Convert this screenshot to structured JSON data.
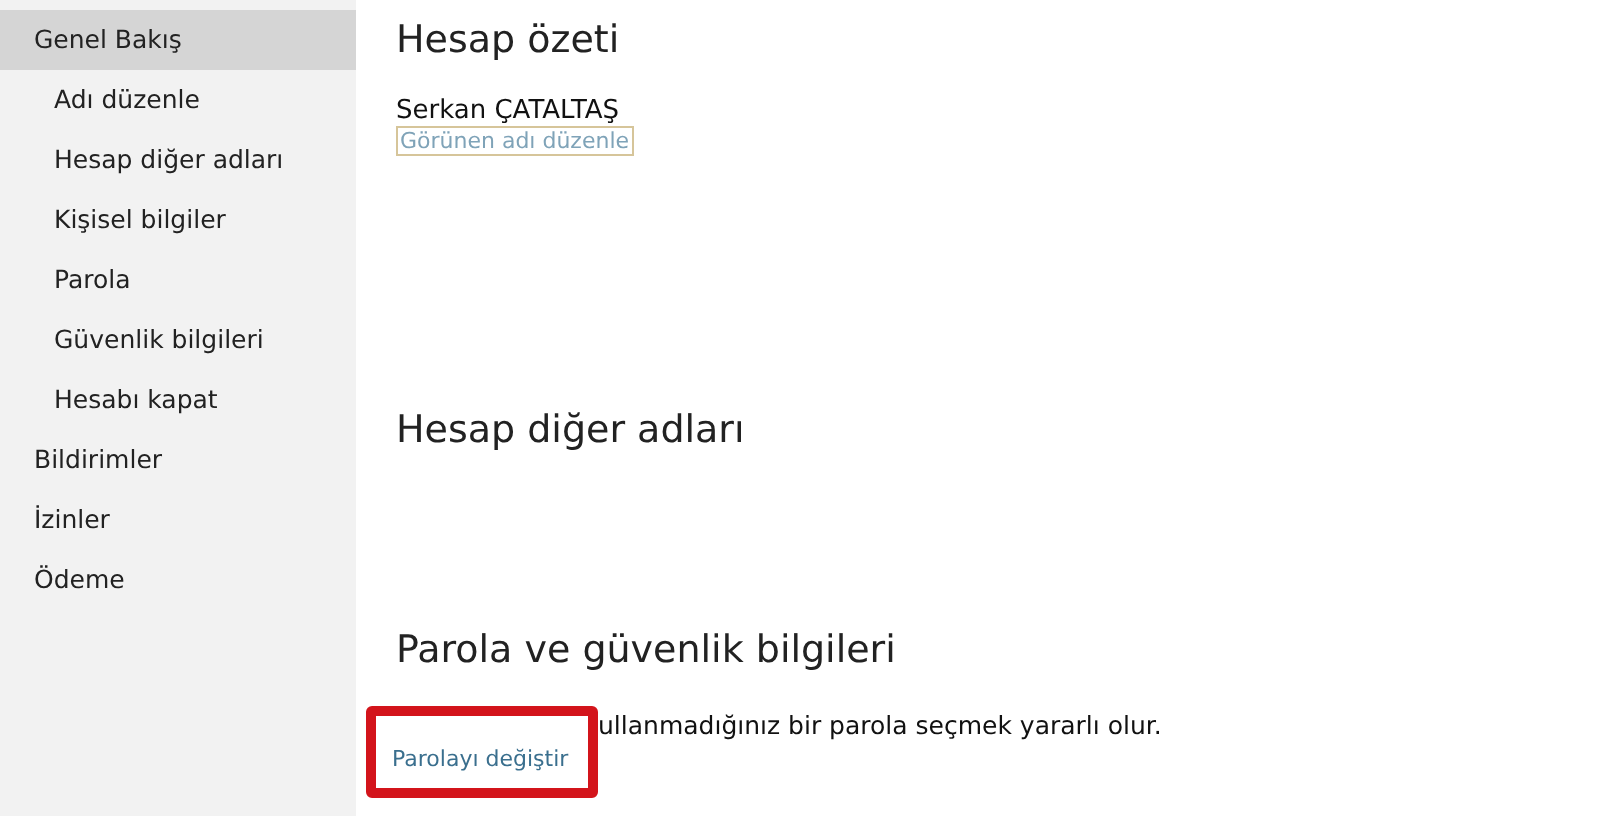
{
  "sidebar": {
    "items": [
      {
        "label": "Genel Bakış",
        "selected": true,
        "children": [
          {
            "label": "Adı düzenle",
            "selected": false
          },
          {
            "label": "Hesap diğer adları",
            "selected": false
          },
          {
            "label": "Kişisel bilgiler",
            "selected": false
          },
          {
            "label": "Parola",
            "selected": false
          },
          {
            "label": "Güvenlik bilgileri",
            "selected": false
          },
          {
            "label": "Hesabı kapat",
            "selected": false
          }
        ]
      },
      {
        "label": "Bildirimler",
        "selected": false
      },
      {
        "label": "İzinler",
        "selected": false
      },
      {
        "label": "Ödeme",
        "selected": false
      }
    ]
  },
  "sections": [
    {
      "title": "Hesap özeti",
      "name": "Serkan ÇATALTAŞ",
      "link": "Görünen adı düzenle",
      "link_focused": true
    },
    {
      "title": "Hesap diğer adları"
    },
    {
      "title": "Parola ve güvenlik bilgileri",
      "text": "ullanmadığınız bir parola seçmek yararlı olur.",
      "link": "Parolayı değiştir",
      "link_highlighted": true
    }
  ]
}
